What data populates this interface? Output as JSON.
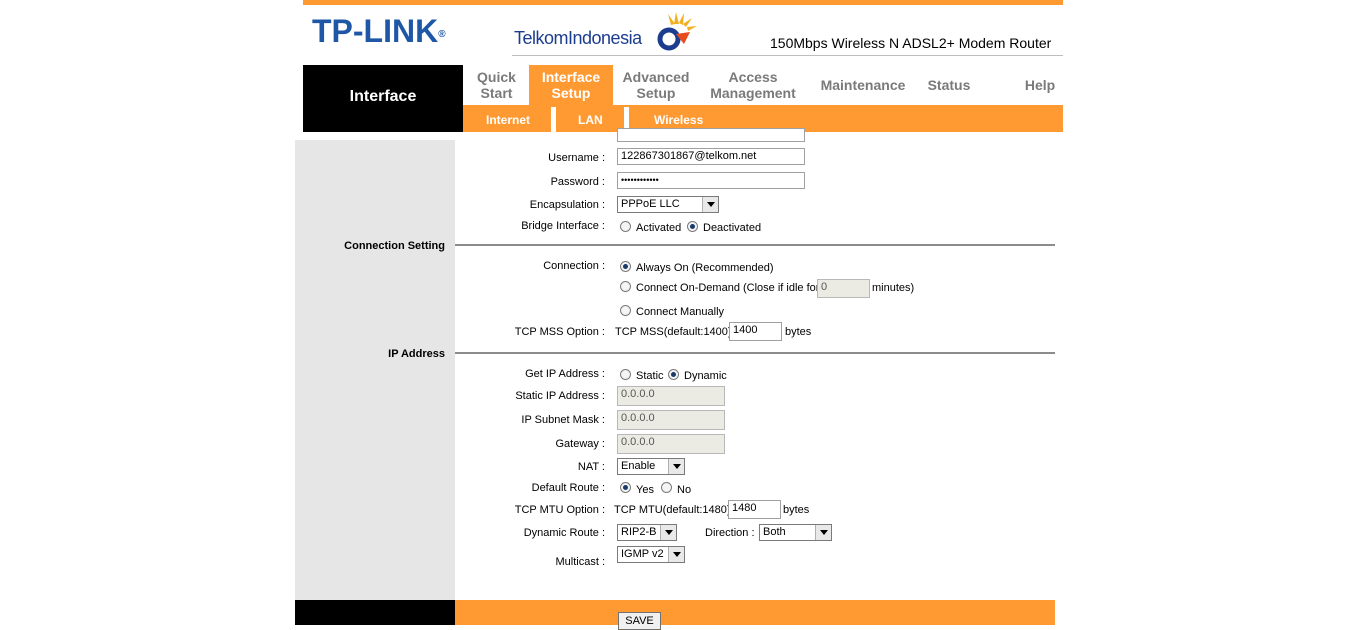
{
  "header": {
    "brand": "TP-LINK",
    "brand_mark": "®",
    "partner": "TelkomIndonesia",
    "model": "150Mbps Wireless N ADSL2+ Modem Router"
  },
  "nav": {
    "section_title": "Interface",
    "tabs": [
      {
        "line1": "Quick",
        "line2": "Start"
      },
      {
        "line1": "Interface",
        "line2": "Setup"
      },
      {
        "line1": "Advanced",
        "line2": "Setup"
      },
      {
        "line1": "Access",
        "line2": "Management"
      },
      {
        "line1": "Maintenance",
        "line2": ""
      },
      {
        "line1": "Status",
        "line2": ""
      },
      {
        "line1": "Help",
        "line2": ""
      }
    ],
    "subtabs": [
      "Internet",
      "LAN",
      "Wireless"
    ]
  },
  "sections": {
    "connection_setting": "Connection Setting",
    "ip_address": "IP Address"
  },
  "pppoe": {
    "username_label": "Username :",
    "username_value": "122867301867@telkom.net",
    "password_label": "Password :",
    "password_value": "••••••••••••",
    "encapsulation_label": "Encapsulation :",
    "encapsulation_value": "PPPoE LLC",
    "bridge_label": "Bridge Interface :",
    "bridge_activated": "Activated",
    "bridge_deactivated": "Deactivated"
  },
  "connection": {
    "label": "Connection :",
    "always_on": "Always On (Recommended)",
    "on_demand": "Connect On-Demand (Close if idle for",
    "idle_value": "0",
    "minutes": "minutes)",
    "manual": "Connect Manually",
    "mss_label": "TCP MSS Option :",
    "mss_text": "TCP MSS(default:1400)",
    "mss_value": "1400",
    "mss_unit": "bytes"
  },
  "ip": {
    "get_label": "Get IP Address :",
    "static": "Static",
    "dynamic": "Dynamic",
    "static_ip_label": "Static IP Address :",
    "static_ip_value": "0.0.0.0",
    "subnet_label": "IP Subnet Mask :",
    "subnet_value": "0.0.0.0",
    "gateway_label": "Gateway :",
    "gateway_value": "0.0.0.0",
    "nat_label": "NAT :",
    "nat_value": "Enable",
    "default_route_label": "Default Route :",
    "yes": "Yes",
    "no": "No",
    "mtu_label": "TCP MTU Option :",
    "mtu_text": "TCP MTU(default:1480)",
    "mtu_value": "1480",
    "mtu_unit": "bytes",
    "dynamic_route_label": "Dynamic Route :",
    "dynamic_route_value": "RIP2-B",
    "direction_label": "Direction :",
    "direction_value": "Both",
    "multicast_label": "Multicast :",
    "multicast_value": "IGMP v2"
  },
  "footer": {
    "save_label": "SAVE"
  },
  "colors": {
    "accent": "#ff9a33",
    "brand_blue": "#1e57a6"
  }
}
